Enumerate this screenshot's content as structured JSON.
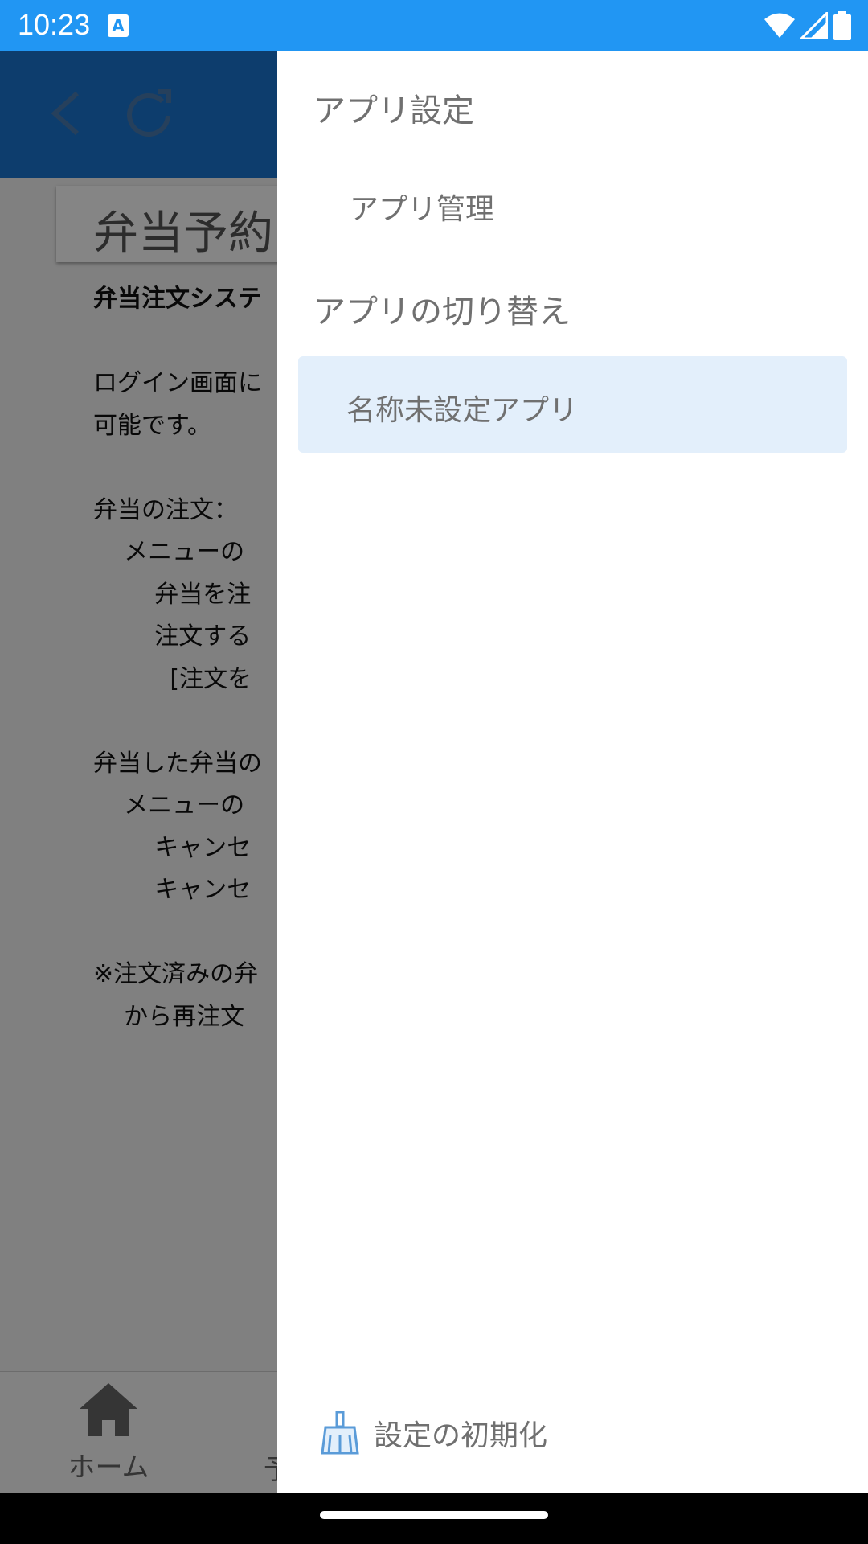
{
  "status_bar": {
    "time": "10:23",
    "notification_icon_letter": "A",
    "icons": [
      "wifi-icon",
      "signal-icon",
      "battery-icon"
    ]
  },
  "app_bar": {
    "icons": [
      "back-icon",
      "refresh-icon"
    ]
  },
  "page": {
    "title": "弁当予約",
    "help_lines": [
      "弁当注文システ",
      "",
      "ログイン画面に",
      "可能です。",
      "",
      "弁当の注文：",
      "    メニューの",
      "        弁当を注",
      "        注文する",
      "          [注文を",
      "",
      "弁当した弁当の",
      "    メニューの",
      "        キャンセ",
      "        キャンセ",
      "",
      "※注文済みの弁",
      "    から再注文"
    ]
  },
  "bottom_nav": {
    "items": [
      {
        "label": "ホーム",
        "icon": "home-icon"
      },
      {
        "label": "予"
      }
    ]
  },
  "drawer": {
    "app_settings_header": "アプリ設定",
    "app_management": "アプリ管理",
    "switch_app_header": "アプリの切り替え",
    "selected_app": "名称未設定アプリ",
    "reset_label": "設定の初期化",
    "reset_icon": "broom-icon"
  },
  "colors": {
    "status_bar": "#2196f3",
    "app_bar": "#1976d2",
    "selected_item_bg": "#e3effb",
    "drawer_text": "#707070"
  }
}
